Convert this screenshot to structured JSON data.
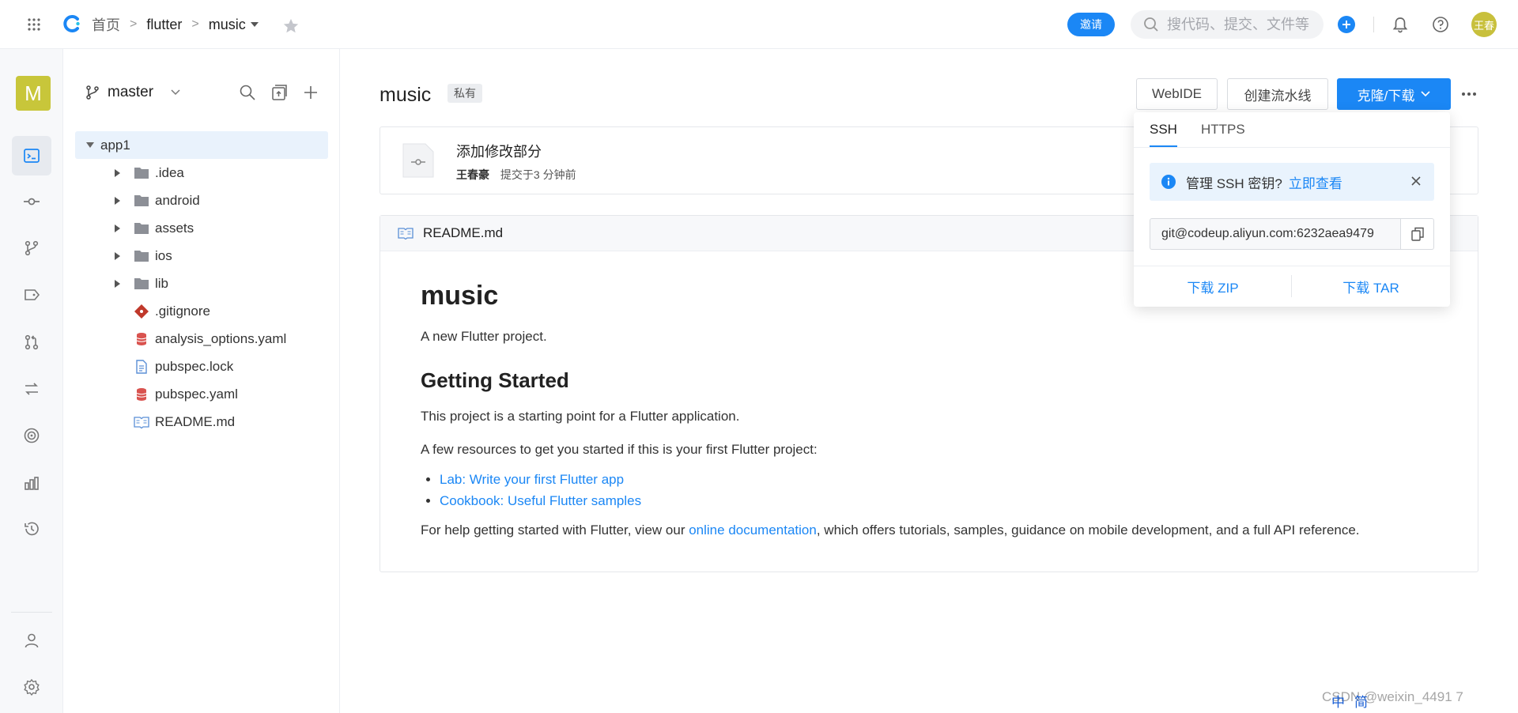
{
  "header": {
    "breadcrumb": [
      "首页",
      "flutter",
      "music"
    ],
    "invite_label": "邀请",
    "search_placeholder": "搜代码、提交、文件等",
    "user_avatar_text": "王春",
    "accent": "#1b87f5"
  },
  "rail": {
    "project_initial": "M",
    "items": [
      "code-icon",
      "commit-icon",
      "branch-icon",
      "tag-icon",
      "merge-request-icon",
      "compare-icon",
      "security-icon",
      "chart-icon",
      "history-icon"
    ],
    "bottom": [
      "member-icon",
      "settings-icon"
    ]
  },
  "tree": {
    "branch": "master",
    "root": "app1",
    "items": [
      {
        "name": ".idea",
        "type": "folder"
      },
      {
        "name": "android",
        "type": "folder"
      },
      {
        "name": "assets",
        "type": "folder"
      },
      {
        "name": "ios",
        "type": "folder"
      },
      {
        "name": "lib",
        "type": "folder"
      },
      {
        "name": ".gitignore",
        "type": "git"
      },
      {
        "name": "analysis_options.yaml",
        "type": "yaml"
      },
      {
        "name": "pubspec.lock",
        "type": "doc"
      },
      {
        "name": "pubspec.yaml",
        "type": "yaml"
      },
      {
        "name": "README.md",
        "type": "readme"
      }
    ]
  },
  "repo": {
    "name": "music",
    "visibility": "私有",
    "webide_label": "WebIDE",
    "pipeline_label": "创建流水线",
    "clone_label": "克隆/下载"
  },
  "commit": {
    "message": "添加修改部分",
    "author": "王春豪",
    "time": "提交于3 分钟前"
  },
  "readme": {
    "filename": "README.md",
    "h1": "music",
    "intro": "A new Flutter project.",
    "h2": "Getting Started",
    "p1": "This project is a starting point for a Flutter application.",
    "p2": "A few resources to get you started if this is your first Flutter project:",
    "links": [
      "Lab: Write your first Flutter app",
      "Cookbook: Useful Flutter samples"
    ],
    "p3_before": "For help getting started with Flutter, view our ",
    "p3_link": "online documentation",
    "p3_after": ", which offers tutorials, samples, guidance on mobile development, and a full API reference."
  },
  "clone": {
    "tabs": [
      "SSH",
      "HTTPS"
    ],
    "alert_text": "管理 SSH 密钥?",
    "alert_link": "立即查看",
    "url": "git@codeup.aliyun.com:6232aea9479",
    "download_zip": "下载 ZIP",
    "download_tar": "下载 TAR"
  },
  "watermark": "CSDN @weixin_4491 7",
  "ime": [
    "中",
    "简"
  ]
}
